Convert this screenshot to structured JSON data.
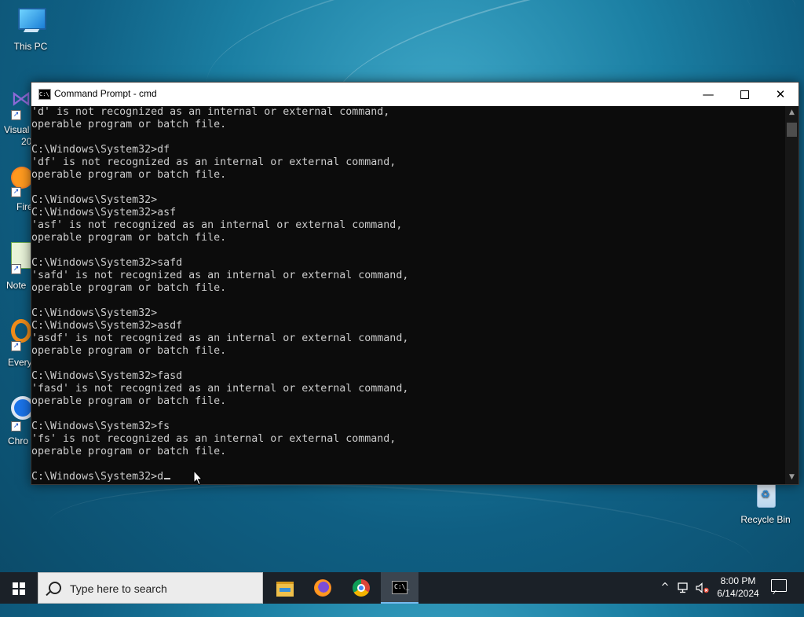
{
  "desktop": {
    "icons": [
      {
        "label": "This PC"
      },
      {
        "label": "Recycle Bin"
      }
    ],
    "partial_labels": [
      "Visual",
      "20",
      "Fire",
      "Note",
      "Every",
      "Chro"
    ]
  },
  "window": {
    "title": "Command Prompt - cmd",
    "min_glyph": "—",
    "close_glyph": "✕",
    "console_lines": [
      "'d' is not recognized as an internal or external command,",
      "operable program or batch file.",
      "",
      "C:\\Windows\\System32>df",
      "'df' is not recognized as an internal or external command,",
      "operable program or batch file.",
      "",
      "C:\\Windows\\System32>",
      "C:\\Windows\\System32>asf",
      "'asf' is not recognized as an internal or external command,",
      "operable program or batch file.",
      "",
      "C:\\Windows\\System32>safd",
      "'safd' is not recognized as an internal or external command,",
      "operable program or batch file.",
      "",
      "C:\\Windows\\System32>",
      "C:\\Windows\\System32>asdf",
      "'asdf' is not recognized as an internal or external command,",
      "operable program or batch file.",
      "",
      "C:\\Windows\\System32>fasd",
      "'fasd' is not recognized as an internal or external command,",
      "operable program or batch file.",
      "",
      "C:\\Windows\\System32>fs",
      "'fs' is not recognized as an internal or external command,",
      "operable program or batch file.",
      ""
    ],
    "prompt_line": "C:\\Windows\\System32>d"
  },
  "taskbar": {
    "search_placeholder": "Type here to search",
    "apps": [
      {
        "name": "file-explorer"
      },
      {
        "name": "firefox"
      },
      {
        "name": "chrome"
      },
      {
        "name": "command-prompt",
        "active": true
      }
    ],
    "tray": {
      "chevron": "^",
      "time": "8:00 PM",
      "date": "6/14/2024"
    }
  }
}
